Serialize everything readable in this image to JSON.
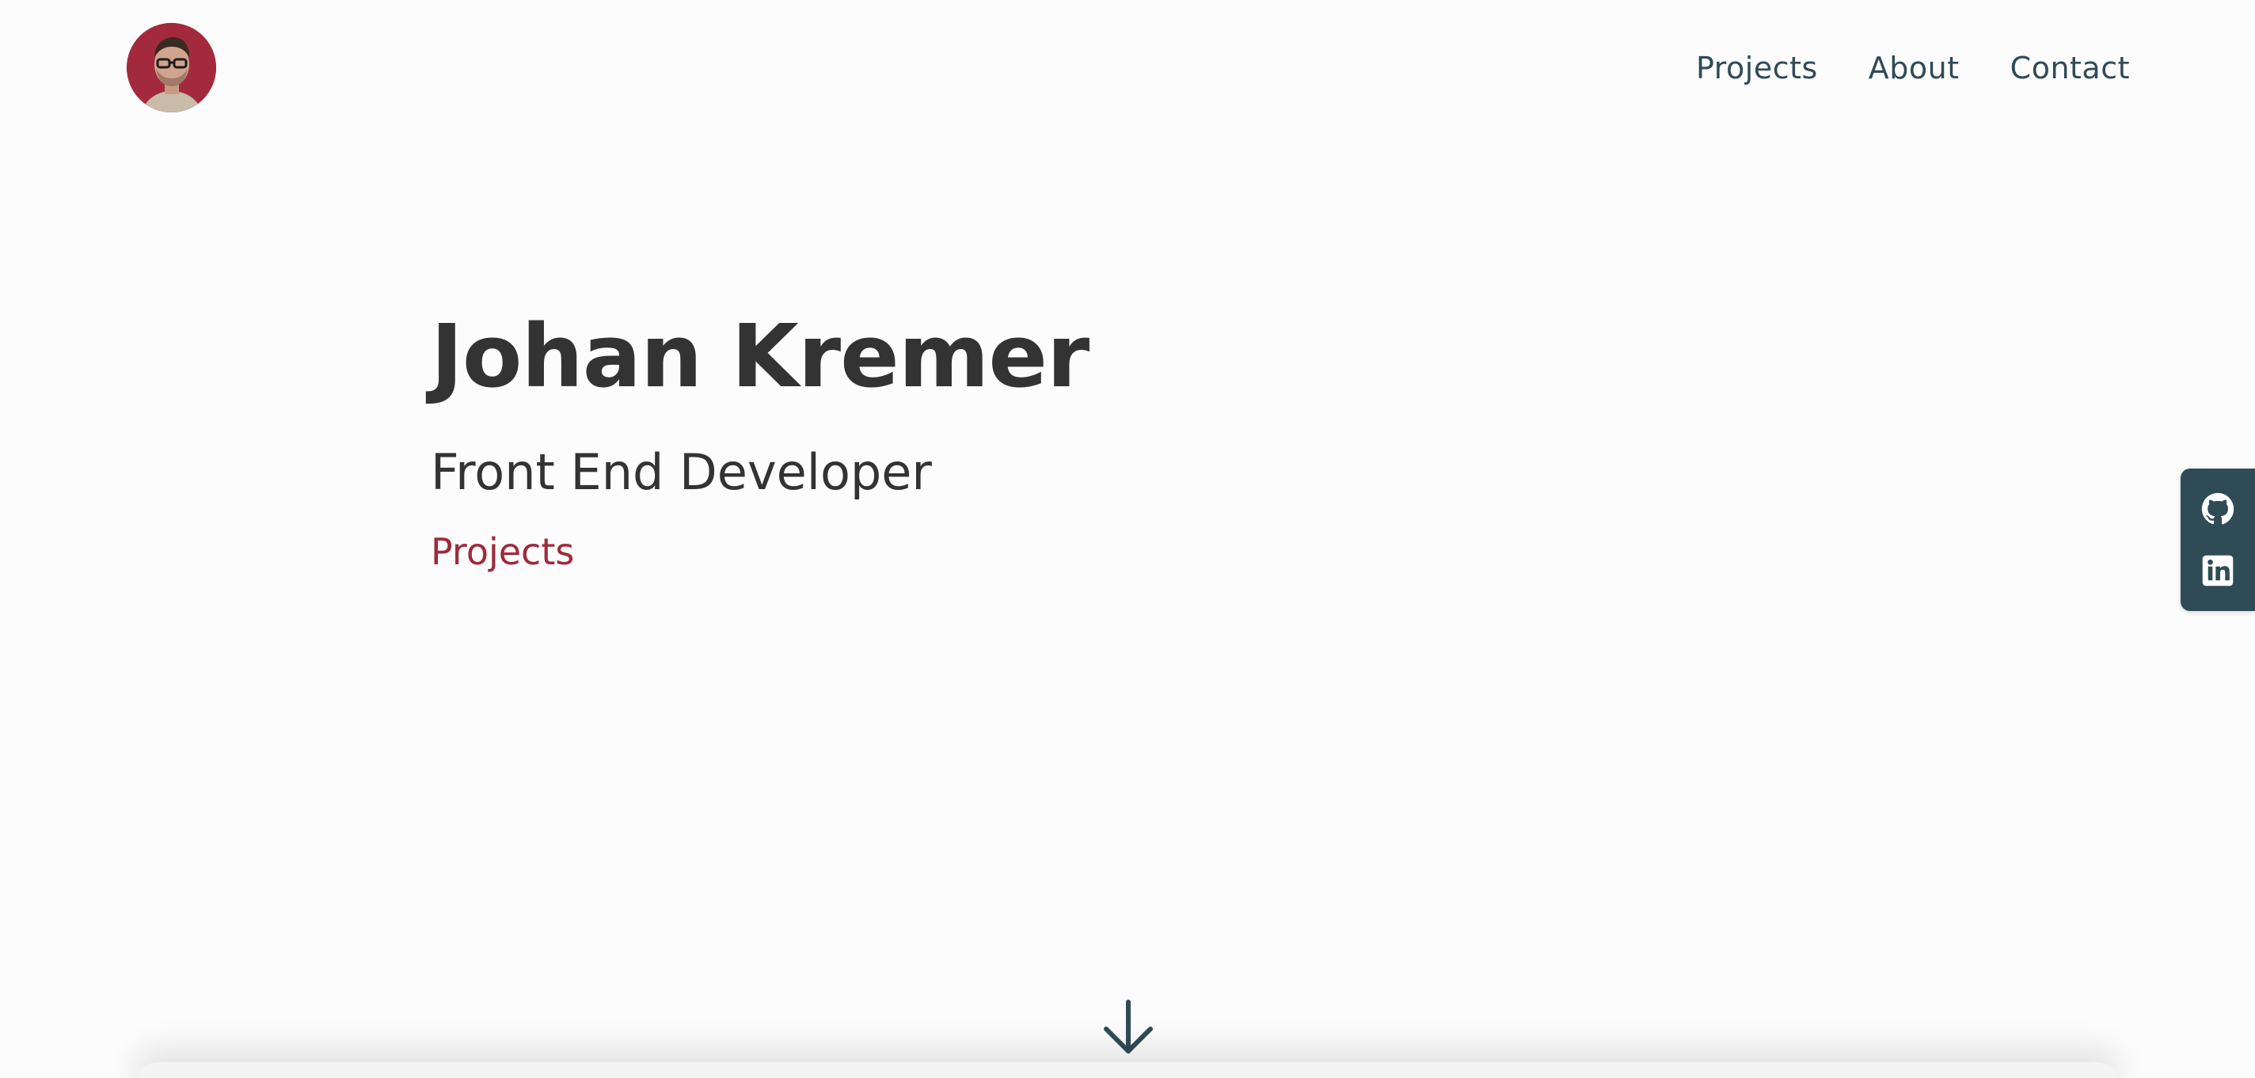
{
  "header": {
    "avatar_alt": "Johan Kremer",
    "nav": [
      {
        "label": "Projects"
      },
      {
        "label": "About"
      },
      {
        "label": "Contact"
      }
    ]
  },
  "hero": {
    "name": "Johan Kremer",
    "role": "Front End Developer",
    "link_label": "Projects"
  },
  "social": {
    "items": [
      {
        "icon": "github-icon"
      },
      {
        "icon": "linkedin-icon"
      }
    ]
  },
  "scroll": {
    "icon": "arrow-down-icon"
  },
  "colors": {
    "background": "#fcfcfc",
    "text": "#333333",
    "nav": "#2f4b56",
    "accent": "#9e2a3b",
    "avatar_bg": "#a32a3c",
    "sidebar": "#2f4b56"
  }
}
